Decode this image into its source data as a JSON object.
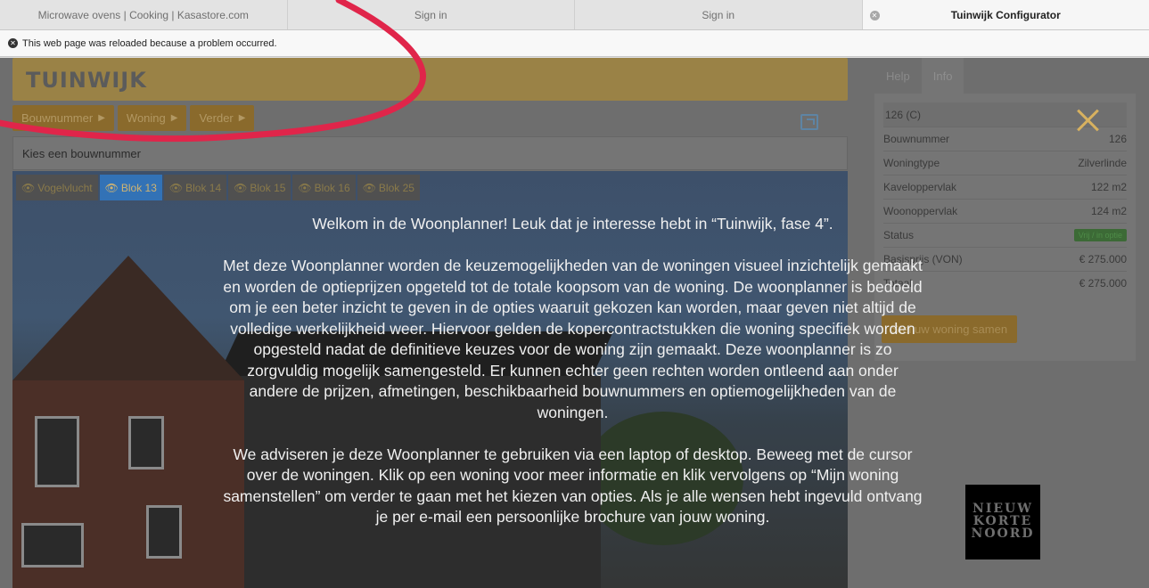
{
  "browser": {
    "tabs": [
      {
        "title": "Microwave ovens | Cooking | Kasastore.com",
        "active": false
      },
      {
        "title": "Sign in",
        "active": false
      },
      {
        "title": "Sign in",
        "active": false
      },
      {
        "title": "Tuinwijk Configurator",
        "active": true
      }
    ],
    "banner": {
      "message": "This web page was reloaded because a problem occurred.",
      "icon": "error-circle-icon"
    }
  },
  "header": {
    "logo_text": "TUINWIJK",
    "accent_color": "#9a8246"
  },
  "nav": {
    "buttons": [
      {
        "label": "Bouwnummer",
        "arrow": "▶"
      },
      {
        "label": "Woning",
        "arrow": "▶"
      },
      {
        "label": "Verder",
        "arrow": "▶"
      }
    ]
  },
  "panel": {
    "title": "Kies een bouwnummer"
  },
  "blocks": {
    "tabs": [
      {
        "label": "Vogelvlucht",
        "active": false
      },
      {
        "label": "Blok 13",
        "active": true
      },
      {
        "label": "Blok 14",
        "active": false
      },
      {
        "label": "Blok 15",
        "active": false
      },
      {
        "label": "Blok 16",
        "active": false
      },
      {
        "label": "Blok 25",
        "active": false
      }
    ]
  },
  "sidebar": {
    "tabs": [
      {
        "label": "Help",
        "active": false
      },
      {
        "label": "Info",
        "active": true
      }
    ],
    "heading": "126 (C)",
    "rows": [
      {
        "label": "Bouwnummer",
        "value": "126"
      },
      {
        "label": "Woningtype",
        "value": "Zilverlinde"
      },
      {
        "label": "Kaveloppervlak",
        "value": "122 m2"
      },
      {
        "label": "Woonoppervlak",
        "value": "124 m2"
      },
      {
        "label": "Status",
        "value": "Vrij / in optie"
      },
      {
        "label": "Basisprijs (VON)",
        "value": "€ 275.000"
      },
      {
        "label": "Totaal",
        "value": "€ 275.000"
      }
    ],
    "compose_button": "Stel uw woning samen"
  },
  "brand_logo": {
    "lines": [
      "NIEUW",
      "KORTE",
      "NOORD"
    ]
  },
  "overlay": {
    "paragraphs": [
      "Welkom in de Woonplanner! Leuk dat je interesse hebt in “Tuinwijk, fase 4”.",
      "Met deze Woonplanner worden de keuzemogelijkheden van de woningen visueel inzichtelijk gemaakt en worden de optieprijzen opgeteld tot de totale koopsom van de woning. De woonplanner is bedoeld om je een beter inzicht te geven in de opties waaruit gekozen kan worden, maar geven niet altijd de volledige werkelijkheid weer. Hiervoor gelden de kopercontractstukken die woning specifiek worden opgesteld nadat de definitieve keuzes voor de woning zijn gemaakt. Deze woonplanner is zo zorgvuldig mogelijk samengesteld. Er kunnen echter geen rechten worden ontleend aan onder andere de prijzen, afmetingen, beschikbaarheid bouwnummers en optiemogelijkheden van de woningen.",
      "We adviseren je deze Woonplanner te gebruiken via een laptop of desktop. Beweeg met de cursor over de woningen. Klik op een woning voor meer informatie en klik vervolgens op “Mijn woning samenstellen” om verder te gaan met het kiezen van opties. Als je alle wensen hebt ingevuld ontvang je per e-mail een persoonlijke brochure van jouw woning."
    ]
  }
}
